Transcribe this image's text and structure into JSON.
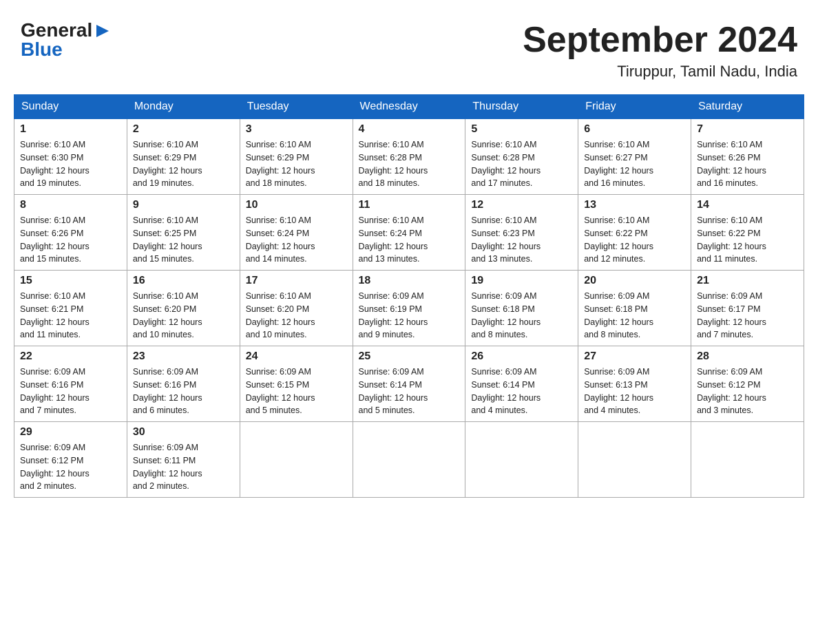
{
  "header": {
    "logo_general": "General",
    "logo_blue": "Blue",
    "title": "September 2024",
    "subtitle": "Tiruppur, Tamil Nadu, India"
  },
  "calendar": {
    "days_of_week": [
      "Sunday",
      "Monday",
      "Tuesday",
      "Wednesday",
      "Thursday",
      "Friday",
      "Saturday"
    ],
    "weeks": [
      [
        {
          "day": "1",
          "sunrise": "6:10 AM",
          "sunset": "6:30 PM",
          "daylight": "12 hours and 19 minutes."
        },
        {
          "day": "2",
          "sunrise": "6:10 AM",
          "sunset": "6:29 PM",
          "daylight": "12 hours and 19 minutes."
        },
        {
          "day": "3",
          "sunrise": "6:10 AM",
          "sunset": "6:29 PM",
          "daylight": "12 hours and 18 minutes."
        },
        {
          "day": "4",
          "sunrise": "6:10 AM",
          "sunset": "6:28 PM",
          "daylight": "12 hours and 18 minutes."
        },
        {
          "day": "5",
          "sunrise": "6:10 AM",
          "sunset": "6:28 PM",
          "daylight": "12 hours and 17 minutes."
        },
        {
          "day": "6",
          "sunrise": "6:10 AM",
          "sunset": "6:27 PM",
          "daylight": "12 hours and 16 minutes."
        },
        {
          "day": "7",
          "sunrise": "6:10 AM",
          "sunset": "6:26 PM",
          "daylight": "12 hours and 16 minutes."
        }
      ],
      [
        {
          "day": "8",
          "sunrise": "6:10 AM",
          "sunset": "6:26 PM",
          "daylight": "12 hours and 15 minutes."
        },
        {
          "day": "9",
          "sunrise": "6:10 AM",
          "sunset": "6:25 PM",
          "daylight": "12 hours and 15 minutes."
        },
        {
          "day": "10",
          "sunrise": "6:10 AM",
          "sunset": "6:24 PM",
          "daylight": "12 hours and 14 minutes."
        },
        {
          "day": "11",
          "sunrise": "6:10 AM",
          "sunset": "6:24 PM",
          "daylight": "12 hours and 13 minutes."
        },
        {
          "day": "12",
          "sunrise": "6:10 AM",
          "sunset": "6:23 PM",
          "daylight": "12 hours and 13 minutes."
        },
        {
          "day": "13",
          "sunrise": "6:10 AM",
          "sunset": "6:22 PM",
          "daylight": "12 hours and 12 minutes."
        },
        {
          "day": "14",
          "sunrise": "6:10 AM",
          "sunset": "6:22 PM",
          "daylight": "12 hours and 11 minutes."
        }
      ],
      [
        {
          "day": "15",
          "sunrise": "6:10 AM",
          "sunset": "6:21 PM",
          "daylight": "12 hours and 11 minutes."
        },
        {
          "day": "16",
          "sunrise": "6:10 AM",
          "sunset": "6:20 PM",
          "daylight": "12 hours and 10 minutes."
        },
        {
          "day": "17",
          "sunrise": "6:10 AM",
          "sunset": "6:20 PM",
          "daylight": "12 hours and 10 minutes."
        },
        {
          "day": "18",
          "sunrise": "6:09 AM",
          "sunset": "6:19 PM",
          "daylight": "12 hours and 9 minutes."
        },
        {
          "day": "19",
          "sunrise": "6:09 AM",
          "sunset": "6:18 PM",
          "daylight": "12 hours and 8 minutes."
        },
        {
          "day": "20",
          "sunrise": "6:09 AM",
          "sunset": "6:18 PM",
          "daylight": "12 hours and 8 minutes."
        },
        {
          "day": "21",
          "sunrise": "6:09 AM",
          "sunset": "6:17 PM",
          "daylight": "12 hours and 7 minutes."
        }
      ],
      [
        {
          "day": "22",
          "sunrise": "6:09 AM",
          "sunset": "6:16 PM",
          "daylight": "12 hours and 7 minutes."
        },
        {
          "day": "23",
          "sunrise": "6:09 AM",
          "sunset": "6:16 PM",
          "daylight": "12 hours and 6 minutes."
        },
        {
          "day": "24",
          "sunrise": "6:09 AM",
          "sunset": "6:15 PM",
          "daylight": "12 hours and 5 minutes."
        },
        {
          "day": "25",
          "sunrise": "6:09 AM",
          "sunset": "6:14 PM",
          "daylight": "12 hours and 5 minutes."
        },
        {
          "day": "26",
          "sunrise": "6:09 AM",
          "sunset": "6:14 PM",
          "daylight": "12 hours and 4 minutes."
        },
        {
          "day": "27",
          "sunrise": "6:09 AM",
          "sunset": "6:13 PM",
          "daylight": "12 hours and 4 minutes."
        },
        {
          "day": "28",
          "sunrise": "6:09 AM",
          "sunset": "6:12 PM",
          "daylight": "12 hours and 3 minutes."
        }
      ],
      [
        {
          "day": "29",
          "sunrise": "6:09 AM",
          "sunset": "6:12 PM",
          "daylight": "12 hours and 2 minutes."
        },
        {
          "day": "30",
          "sunrise": "6:09 AM",
          "sunset": "6:11 PM",
          "daylight": "12 hours and 2 minutes."
        },
        null,
        null,
        null,
        null,
        null
      ]
    ],
    "sunrise_label": "Sunrise:",
    "sunset_label": "Sunset:",
    "daylight_label": "Daylight:"
  }
}
